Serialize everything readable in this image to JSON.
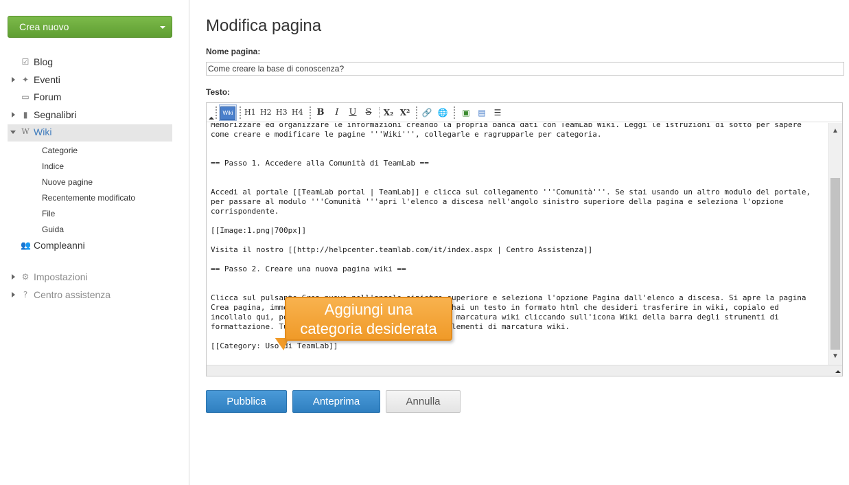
{
  "sidebar": {
    "create_button": "Crea nuovo",
    "items": [
      {
        "label": "Blog",
        "icon": "edit-icon"
      },
      {
        "label": "Eventi",
        "icon": "pin-icon"
      },
      {
        "label": "Forum",
        "icon": "speech-bubble-icon"
      },
      {
        "label": "Segnalibri",
        "icon": "bookmark-icon"
      },
      {
        "label": "Wiki",
        "icon": "wiki-w-icon"
      },
      {
        "label": "Compleanni",
        "icon": "people-icon"
      },
      {
        "label": "Impostazioni",
        "icon": "gear-icon"
      },
      {
        "label": "Centro assistenza",
        "icon": "question-icon"
      }
    ],
    "wiki_subitems": [
      "Categorie",
      "Indice",
      "Nuove pagine",
      "Recentemente modificato",
      "File",
      "Guida"
    ]
  },
  "main": {
    "title": "Modifica pagina",
    "name_label": "Nome pagina:",
    "name_value": "Come creare la base di conoscenza?",
    "text_label": "Testo:",
    "toolbar": {
      "wiki": "Wiki",
      "h1": "H1",
      "h2": "H2",
      "h3": "H3",
      "h4": "H4",
      "bold": "B",
      "italic": "I",
      "underline": "U",
      "strike": "S",
      "subscript": "X₂",
      "superscript": "X²"
    },
    "editor_lines": [
      "Memorizzare ed organizzare le informazioni creando la propria banca dati con TeamLab Wiki. Leggi le istruzioni di sotto per sapere come creare e modificare le pagine '''Wiki''', collegarle e ragrupparle per categoria.",
      "",
      "",
      "== Passo 1. Accedere alla Comunità di TeamLab ==",
      "",
      "",
      "Accedi al portale [[TeamLab portal | TeamLab]] e clicca sul collegamento '''Comunità'''. Se stai usando un altro modulo del portale, per passare al modulo '''Comunità '''apri l'elenco a discesa nell'angolo sinistro superiore della pagina e seleziona l'opzione corrispondente.",
      "",
      "[[Image:1.png|700px]]",
      "",
      "Visita il nostro [[http://helpcenter.teamlab.com/it/index.aspx | Centro Assistenza]]",
      "",
      "== Passo 2. Creare una nuova pagina wiki ==",
      "",
      "",
      "Clicca sul pulsante Crea nuovo nell'angolo sinistro superiore e seleziona l'opzione Pagina dall'elenco a discesa. Si apre la pagina Crea pagina, immetti il titolo e digita il testo. Se hai un testo in formato html che desideri trasferire in wiki, copialo ed incollalo qui, poi vai alla scheda Testo ed attiva la marcatura wiki cliccando sull'icona Wiki della barra degli strumenti di formattazione. Tutti i tag saranno sostituiti dagli elementi di marcatura wiki.",
      "",
      "[[Category: Uso di TeamLab]]"
    ],
    "callout": {
      "line1": "Aggiungi una",
      "line2": "categoria desiderata"
    },
    "buttons": {
      "publish": "Pubblica",
      "preview": "Anteprima",
      "cancel": "Annulla"
    }
  },
  "colors": {
    "create_green": "#6aab3c",
    "primary_blue": "#3a8bcd",
    "wiki_active_link": "#3f7cbd",
    "callout_orange": "#f3a236"
  }
}
